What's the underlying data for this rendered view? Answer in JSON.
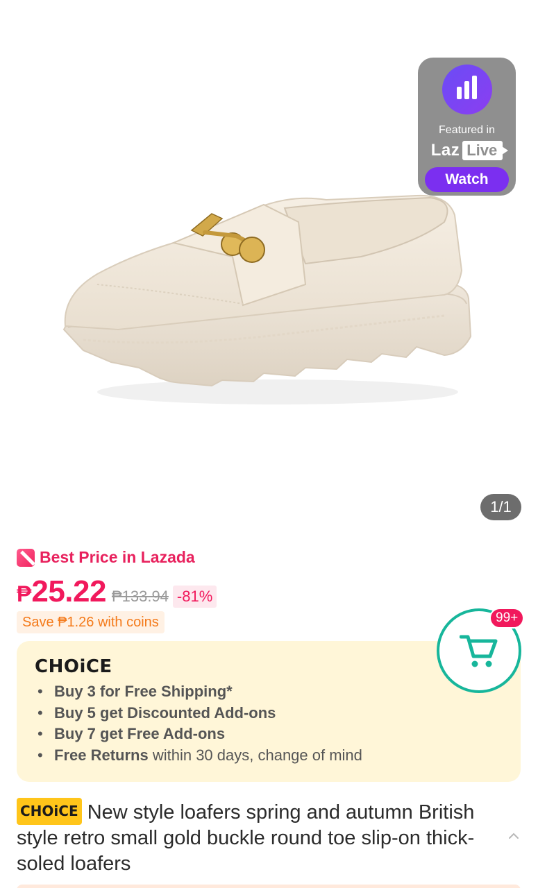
{
  "gallery": {
    "counter": "1/1"
  },
  "live": {
    "featured": "Featured in",
    "brand": "Laz",
    "brand_pill": "Live",
    "watch": "Watch"
  },
  "price": {
    "best_label": "Best Price in Lazada",
    "currency": "₱",
    "current": "25.22",
    "original": "₱133.94",
    "discount": "-81%",
    "coins": "Save ₱1.26 with coins"
  },
  "choice": {
    "logo": "CHOiCE",
    "items": [
      {
        "bold": "Buy 3 for  Free Shipping*",
        "rest": ""
      },
      {
        "bold": "Buy 5 get Discounted Add-ons",
        "rest": ""
      },
      {
        "bold": "Buy 7 get Free Add-ons",
        "rest": ""
      },
      {
        "bold": "Free Returns",
        "rest": " within 30 days, change of mind"
      }
    ]
  },
  "cart": {
    "badge": "99+"
  },
  "product": {
    "tag": "CHOiCE",
    "title": "New style loafers spring and autumn British style retro small gold buckle round toe slip-on thick-soled loafers"
  },
  "colors": {
    "price": "#f1195c",
    "accent_purple": "#7b2ff0",
    "cart_teal": "#17b69b",
    "choice_bg": "#fff6d8",
    "choice_tag": "#ffc51a"
  }
}
